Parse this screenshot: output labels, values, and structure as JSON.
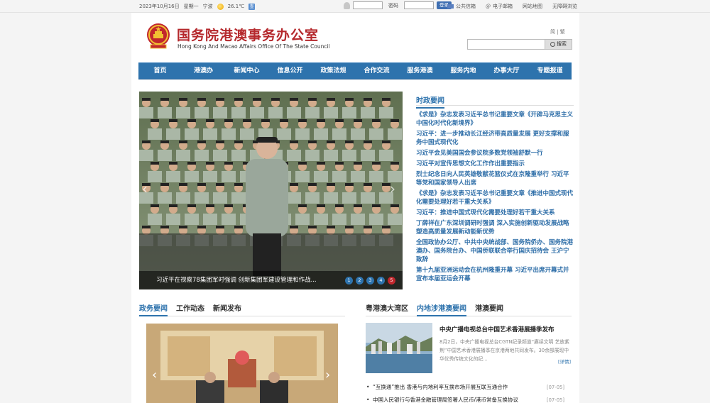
{
  "topbar": {
    "date": "2023年10月16日",
    "weekday": "星期一",
    "city": "宁波",
    "temperature": "26.1℃",
    "weather_icon": "sun-icon",
    "weather_btn": "查",
    "password_label": "密码",
    "login_label": "登录",
    "links": [
      "公共信箱",
      "电子邮箱",
      "网站地图",
      "无障碍浏览"
    ]
  },
  "header": {
    "title_cn": "国务院港澳事务办公室",
    "title_en": "Hong Kong And Macao Affairs Office Of The State Council",
    "lang_switch": "简 | 繁",
    "search_button": "搜索"
  },
  "nav": [
    "首页",
    "港澳办",
    "新闻中心",
    "信息公开",
    "政策法规",
    "合作交流",
    "服务港澳",
    "服务内地",
    "办事大厅",
    "专题报道"
  ],
  "carousel": {
    "caption": "习近平在视察78集团军时强调 创新集团军建设管理和作战...",
    "pages": [
      "1",
      "2",
      "3",
      "4",
      "5"
    ],
    "active_index": 4
  },
  "politics": {
    "section_title": "时政要闻",
    "items": [
      "《求是》杂志发表习近平总书记重要文章《开辟马克思主义中国化时代化新境界》",
      "习近平：进一步推动长江经济带高质量发展 更好支撑和服务中国式现代化",
      "习近平会见美国国会参议院多数党领袖舒默一行",
      "习近平对宣传思想文化工作作出重要指示",
      "烈士纪念日向人民英雄敬献花篮仪式在京隆重举行 习近平等党和国家领导人出席",
      "《求是》杂志发表习近平总书记重要文章《推进中国式现代化需要处理好若干重大关系》",
      "习近平：推进中国式现代化需要处理好若干重大关系",
      "丁薛祥在广东深圳调研时强调 深入实施创新驱动发展战略 塑造高质量发展新动能新优势",
      "全国政协办公厅、中共中央统战部、国务院侨办、国务院港澳办、国务院台办、中国侨联联合举行国庆招待会 王沪宁致辞",
      "第十九届亚洲运动会在杭州隆重开幕 习近平出席开幕式并宣布本届亚运会开幕"
    ]
  },
  "left_tabs": [
    "政务要闻",
    "工作动态",
    "新闻发布"
  ],
  "right_tabs": [
    "粤港澳大湾区",
    "内地涉港澳要闻",
    "港澳要闻"
  ],
  "feature": {
    "title": "中央广播电视总台中国艺术香港展播季发布",
    "desc": "8月2日，中央广播电视总台CGTN纪录频道“赓续文明 艺放紫荆”中国艺术香港展播季在京港两地共同发布。30余部展现中华优秀传统文化的纪...",
    "more": "[详情]"
  },
  "list": [
    {
      "title": "“互换通”推出 香港与内地利率互换市场开展互联互通合作",
      "date": "[07-05]"
    },
    {
      "title": "中国人民银行与香港金融管理局签署人民币/港币常备互换协议",
      "date": "[07-05]"
    }
  ]
}
